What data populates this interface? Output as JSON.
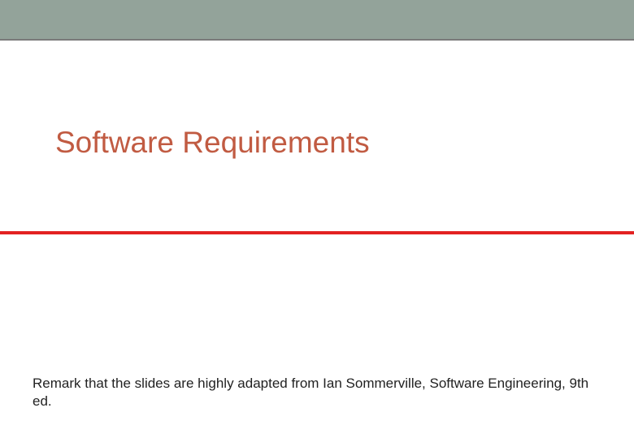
{
  "slide": {
    "title": "Software Requirements",
    "remark": "Remark that the slides are highly adapted from Ian Sommerville, Software Engineering, 9th ed."
  }
}
